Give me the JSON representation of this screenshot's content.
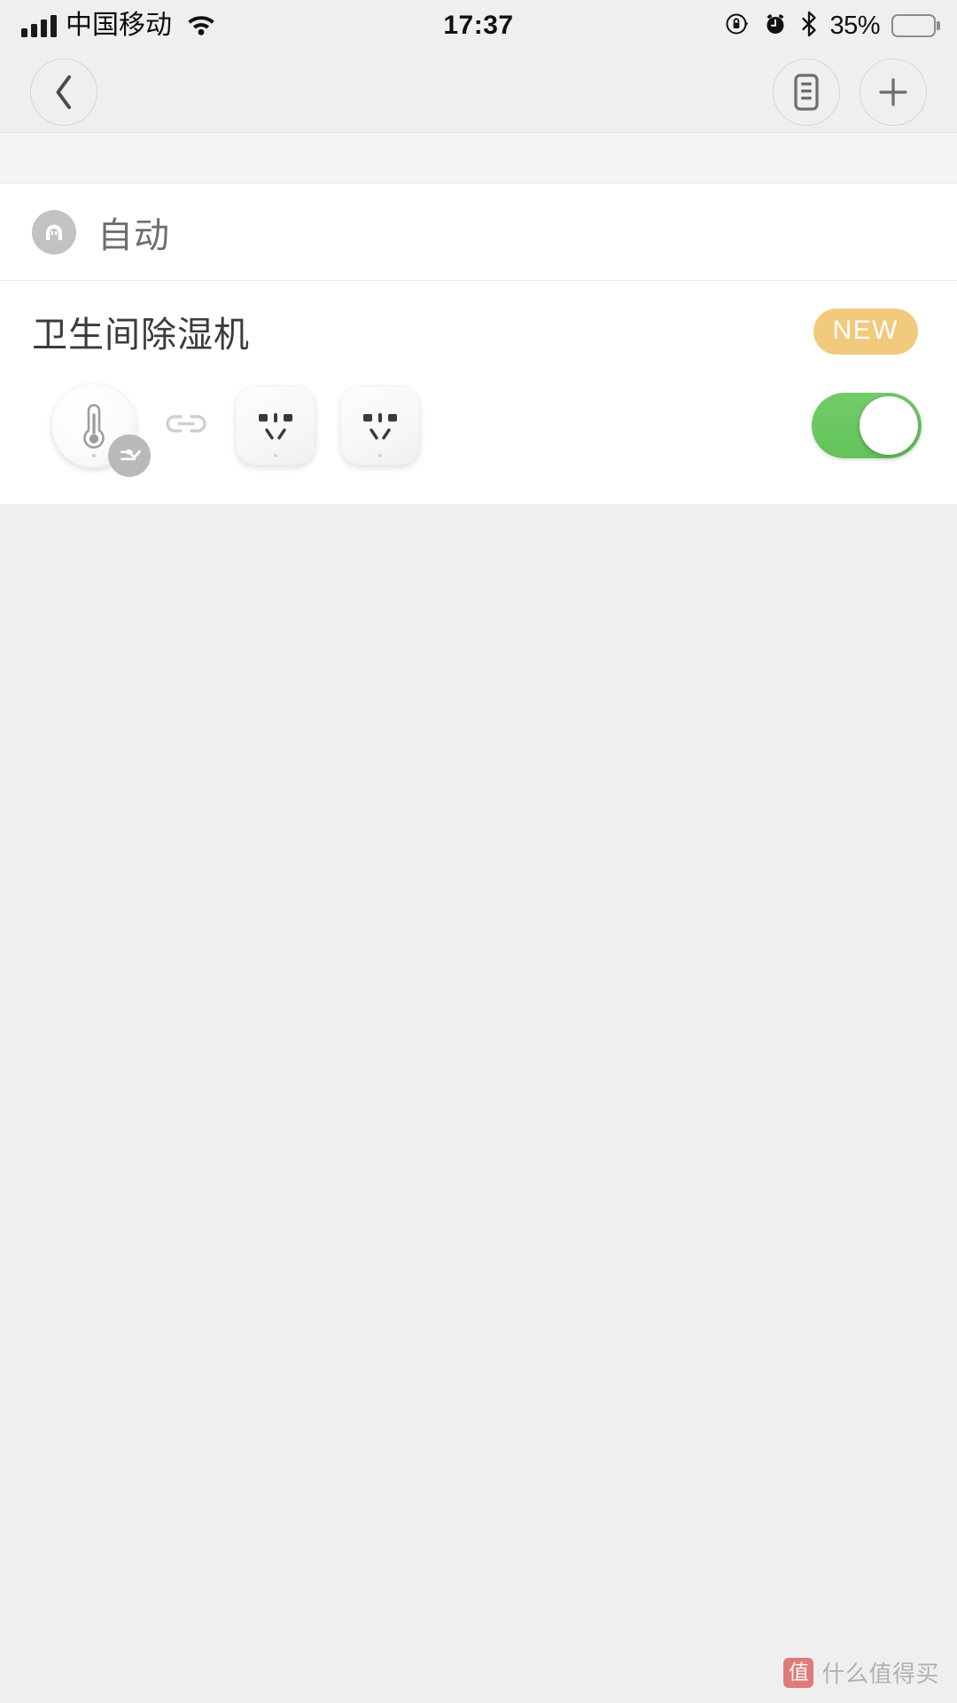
{
  "status_bar": {
    "carrier": "中国移动",
    "time": "17:37",
    "battery_percent": "35%",
    "icons": {
      "signal": "signal-bars-icon",
      "wifi": "wifi-icon",
      "rotation_lock": "rotation-lock-icon",
      "alarm": "alarm-clock-icon",
      "bluetooth": "bluetooth-icon",
      "battery": "battery-icon"
    },
    "battery_level": 35
  },
  "nav_bar": {
    "back_label": "back-chevron",
    "log_label": "automation-log",
    "add_label": "add-automation"
  },
  "section": {
    "icon": "home-socket-icon",
    "title": "自动"
  },
  "automations": [
    {
      "name": "卫生间除湿机",
      "badge": "NEW",
      "enabled": true,
      "trigger_device": {
        "type": "temperature-humidity-sensor",
        "icon": "thermometer-icon",
        "badge_icon": "settings-check-icon"
      },
      "action_devices": [
        {
          "type": "smart-plug",
          "icon": "power-socket-icon"
        },
        {
          "type": "smart-plug",
          "icon": "power-socket-icon"
        }
      ],
      "link_icon": "chain-link-icon"
    }
  ],
  "watermark": {
    "logo": "值",
    "text": "什么值得买"
  },
  "colors": {
    "toggle_on": "#66C65D",
    "badge_new": "#F2CA7D",
    "page_bg": "#EFEFEF",
    "card_bg": "#FFFFFF",
    "title_text": "#3B3B3B",
    "section_text": "#6E6E6E"
  }
}
